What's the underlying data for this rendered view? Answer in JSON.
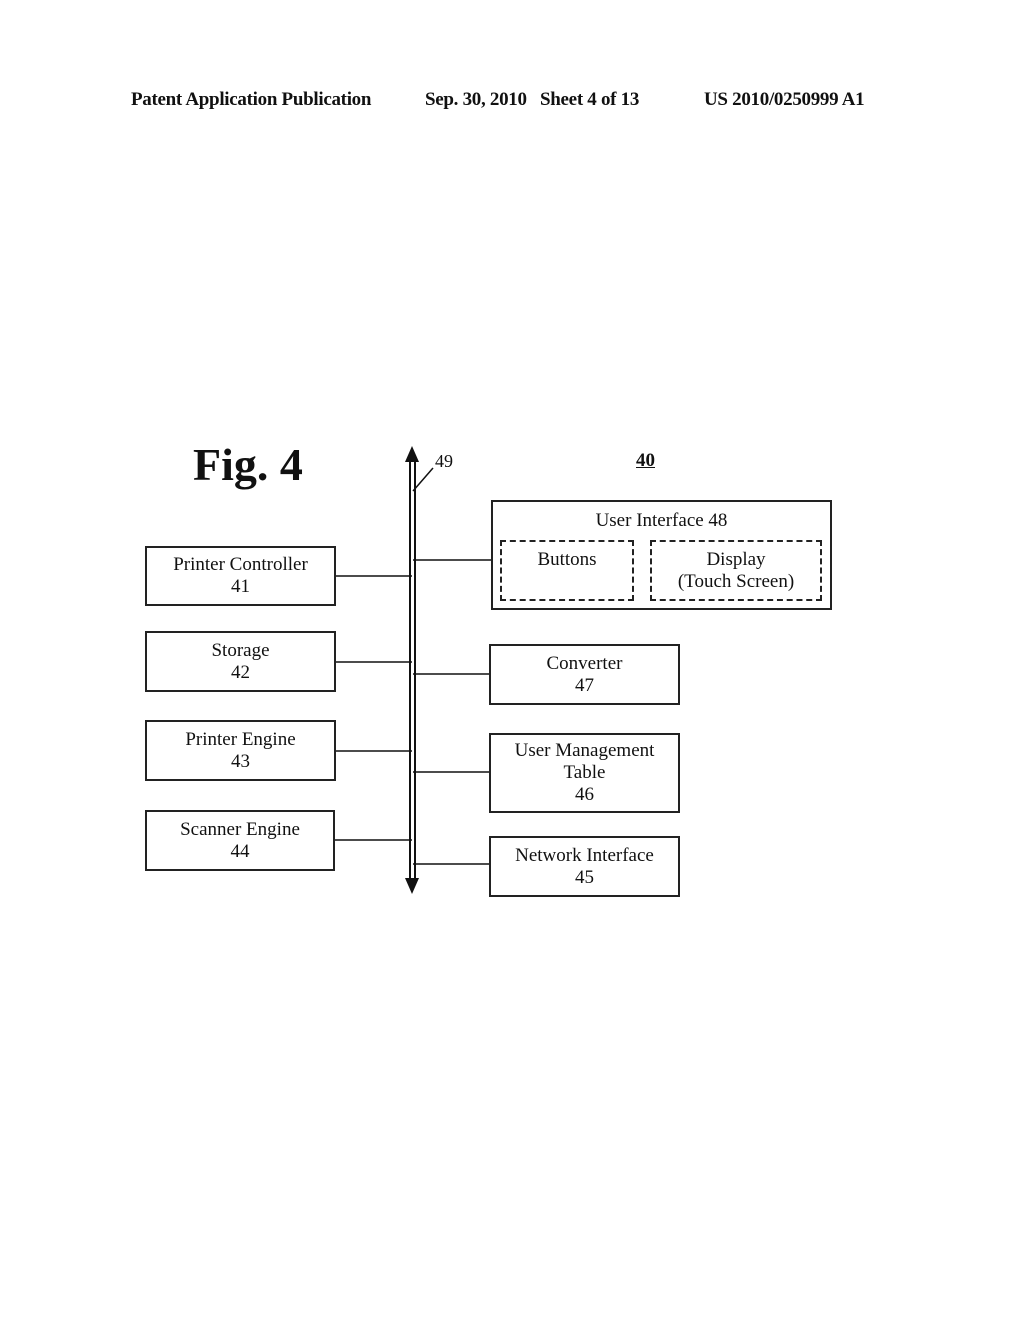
{
  "header": {
    "publication": "Patent Application Publication",
    "date_sheet": "Sep. 30, 2010   Sheet 4 of 13",
    "number": "US 2010/0250999 A1"
  },
  "figure": {
    "title": "Fig. 4",
    "device_ref": "40",
    "bus_ref": "49"
  },
  "left_blocks": [
    {
      "label": "Printer Controller",
      "ref": "41"
    },
    {
      "label": "Storage",
      "ref": "42"
    },
    {
      "label": "Printer Engine",
      "ref": "43"
    },
    {
      "label": "Scanner Engine",
      "ref": "44"
    }
  ],
  "user_interface": {
    "title": "User Interface 48",
    "buttons_label": "Buttons",
    "display_label": "Display",
    "display_sublabel": "(Touch Screen)"
  },
  "right_blocks": [
    {
      "label": "Converter",
      "ref": "47"
    },
    {
      "label": "User Management",
      "label2": "Table",
      "ref": "46"
    },
    {
      "label": "Network Interface",
      "ref": "45"
    }
  ]
}
